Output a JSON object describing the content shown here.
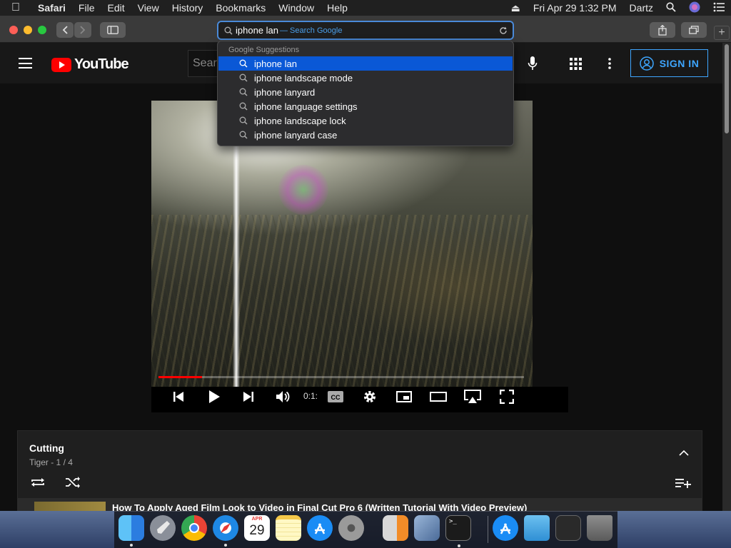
{
  "menubar": {
    "app": "Safari",
    "items": [
      "File",
      "Edit",
      "View",
      "History",
      "Bookmarks",
      "Window",
      "Help"
    ],
    "datetime": "Fri Apr 29  1:32 PM",
    "user": "Dartz"
  },
  "safari": {
    "address_query": "iphone lan",
    "address_hint": "— Search Google"
  },
  "suggestions": {
    "header": "Google Suggestions",
    "items": [
      "iphone lan",
      "iphone landscape mode",
      "iphone lanyard",
      "iphone language settings",
      "iphone landscape lock",
      "iphone lanyard case"
    ],
    "selected_index": 0
  },
  "youtube": {
    "logo_text": "YouTube",
    "search_placeholder": "Searc",
    "sign_in": "SIGN IN"
  },
  "player": {
    "time": "0:1:",
    "progress": 0.12
  },
  "playlist": {
    "title": "Cutting",
    "subtitle": "Tiger - 1 / 4",
    "current_video": "How To Apply Aged Film Look to Video in Final Cut Pro 6 (Written Tutorial With Video Preview)"
  },
  "dock": {
    "calendar_month": "APR",
    "calendar_day": "29"
  },
  "colors": {
    "accent_blue": "#0a58d6",
    "youtube_red": "#ff0000",
    "signin_blue": "#3ea6ff"
  }
}
